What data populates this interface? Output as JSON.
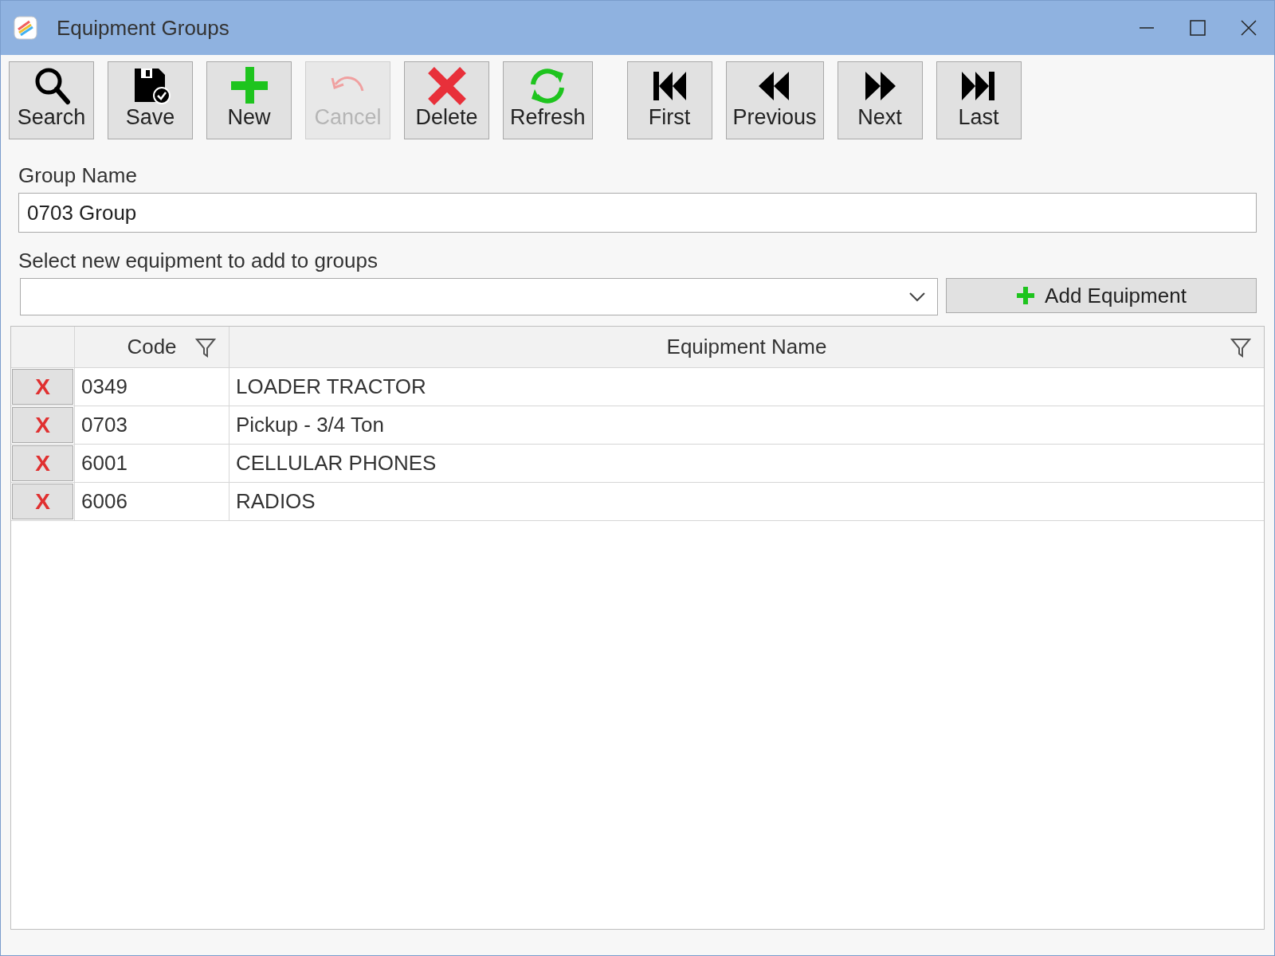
{
  "window": {
    "title": "Equipment Groups"
  },
  "toolbar": [
    {
      "label": "Search",
      "kind": "search",
      "disabled": false
    },
    {
      "label": "Save",
      "kind": "save",
      "disabled": false
    },
    {
      "label": "New",
      "kind": "new",
      "disabled": false
    },
    {
      "label": "Cancel",
      "kind": "cancel",
      "disabled": true
    },
    {
      "label": "Delete",
      "kind": "delete",
      "disabled": false
    },
    {
      "label": "Refresh",
      "kind": "refresh",
      "disabled": false
    }
  ],
  "navigation": [
    {
      "label": "First",
      "kind": "first",
      "disabled": false
    },
    {
      "label": "Previous",
      "kind": "previous",
      "disabled": false
    },
    {
      "label": "Next",
      "kind": "next",
      "disabled": false
    },
    {
      "label": "Last",
      "kind": "last",
      "disabled": false
    }
  ],
  "group_name": {
    "label": "Group Name",
    "value": "0703 Group"
  },
  "equipment_select": {
    "label": "Select new equipment to add to groups",
    "button": "Add Equipment"
  },
  "table": {
    "columns": [
      "Code",
      "Equipment Name"
    ],
    "rows": [
      {
        "remove": "X",
        "code": "0349",
        "name": "LOADER TRACTOR"
      },
      {
        "remove": "X",
        "code": "0703",
        "name": "Pickup - 3/4 Ton"
      },
      {
        "remove": "X",
        "code": "6001",
        "name": "CELLULAR PHONES"
      },
      {
        "remove": "X",
        "code": "6006",
        "name": "RADIOS"
      }
    ]
  }
}
